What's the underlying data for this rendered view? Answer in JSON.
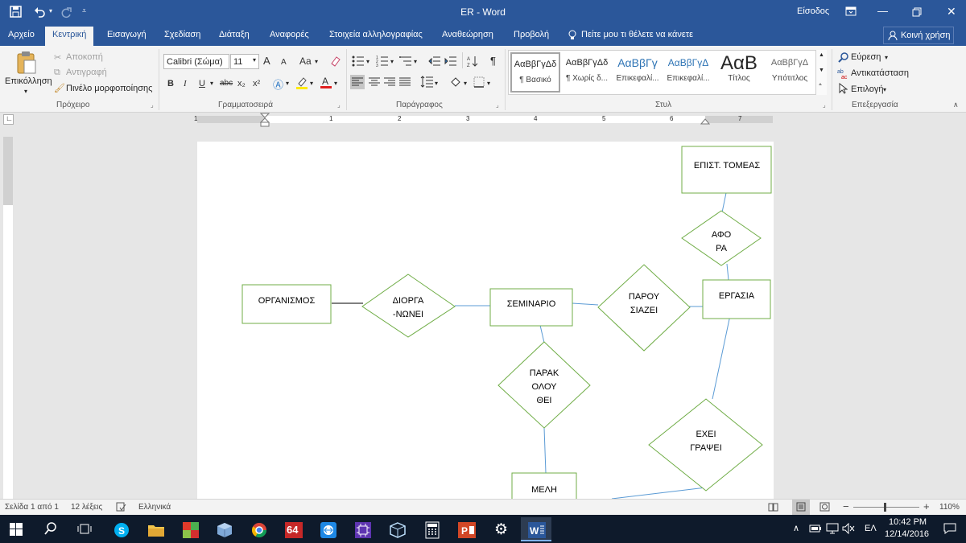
{
  "app": {
    "window_title": "ER - Word",
    "signin": "Είσοδος"
  },
  "tabs": [
    "Αρχείο",
    "Κεντρική",
    "Εισαγωγή",
    "Σχεδίαση",
    "Διάταξη",
    "Αναφορές",
    "Στοιχεία αλληλογραφίας",
    "Αναθεώρηση",
    "Προβολή"
  ],
  "tell_me": "Πείτε μου τι θέλετε να κάνετε",
  "share": "Κοινή χρήση",
  "clipboard": {
    "paste": "Επικόλληση",
    "cut": "Αποκοπή",
    "copy": "Αντιγραφή",
    "format_painter": "Πινέλο μορφοποίησης",
    "label": "Πρόχειρο"
  },
  "font": {
    "name": "Calibri (Σώμα)",
    "size": "11",
    "label": "Γραμματοσειρά",
    "bold": "B",
    "italic": "I",
    "underline": "U",
    "strike": "abc",
    "sub": "x₂",
    "sup": "x²",
    "grow": "A",
    "shrink": "A",
    "case": "Aa"
  },
  "paragraph": {
    "label": "Παράγραφος"
  },
  "styles": {
    "label": "Στυλ",
    "items": [
      {
        "preview": "ΑαΒβΓγΔδ",
        "name": "¶ Βασικό"
      },
      {
        "preview": "ΑαΒβΓγΔδ",
        "name": "¶ Χωρίς δ..."
      },
      {
        "preview": "ΑαΒβΓγ",
        "name": "Επικεφαλί..."
      },
      {
        "preview": "ΑαΒβΓγΔ",
        "name": "Επικεφαλί..."
      },
      {
        "preview": "ΑαΒ",
        "name": "Τίτλος"
      },
      {
        "preview": "ΑαΒβΓγΔ",
        "name": "Υπότιτλος"
      }
    ]
  },
  "editing": {
    "find": "Εύρεση",
    "replace": "Αντικατάσταση",
    "select": "Επιλογή",
    "label": "Επεξεργασία"
  },
  "ruler": {
    "numbers": [
      "1",
      "1",
      "2",
      "3",
      "4",
      "5",
      "6",
      "7"
    ]
  },
  "diagram": {
    "entities": {
      "organismos": "ΟΡΓΑΝΙΣΜΟΣ",
      "seminario": "ΣΕΜΙΝΑΡΙΟ",
      "ergasia": "ΕΡΓΑΣΙΑ",
      "epist_tomeas": "ΕΠΙΣΤ. ΤΟΜΕΑΣ",
      "meli": "ΜΕΛΗ"
    },
    "relations": {
      "diorganonei_1": "ΔΙΟΡΓΑ",
      "diorganonei_2": "-ΝΩΝΕΙ",
      "parousiazei_1": "ΠΑΡΟΥ",
      "parousiazei_2": "ΣΙΑΖΕΙ",
      "afora_1": "ΑΦΟ",
      "afora_2": "ΡΑ",
      "parakolouthei_1": "ΠΑΡΑΚ",
      "parakolouthei_2": "ΟΛΟΥ",
      "parakolouthei_3": "ΘΕΙ",
      "exei_grapsei_1": "ΕΧΕΙ",
      "exei_grapsei_2": "ΓΡΑΨΕΙ"
    }
  },
  "status": {
    "page": "Σελίδα 1 από 1",
    "words": "12 λέξεις",
    "language": "Ελληνικά",
    "zoom": "110%"
  },
  "taskbar": {
    "lang": "ΕΛ",
    "time": "10:42 PM",
    "date": "12/14/2016",
    "app64": "64"
  },
  "colors": {
    "word_blue": "#2b579a",
    "shape_green": "#70ad47",
    "connector_blue": "#5b9bd5"
  }
}
